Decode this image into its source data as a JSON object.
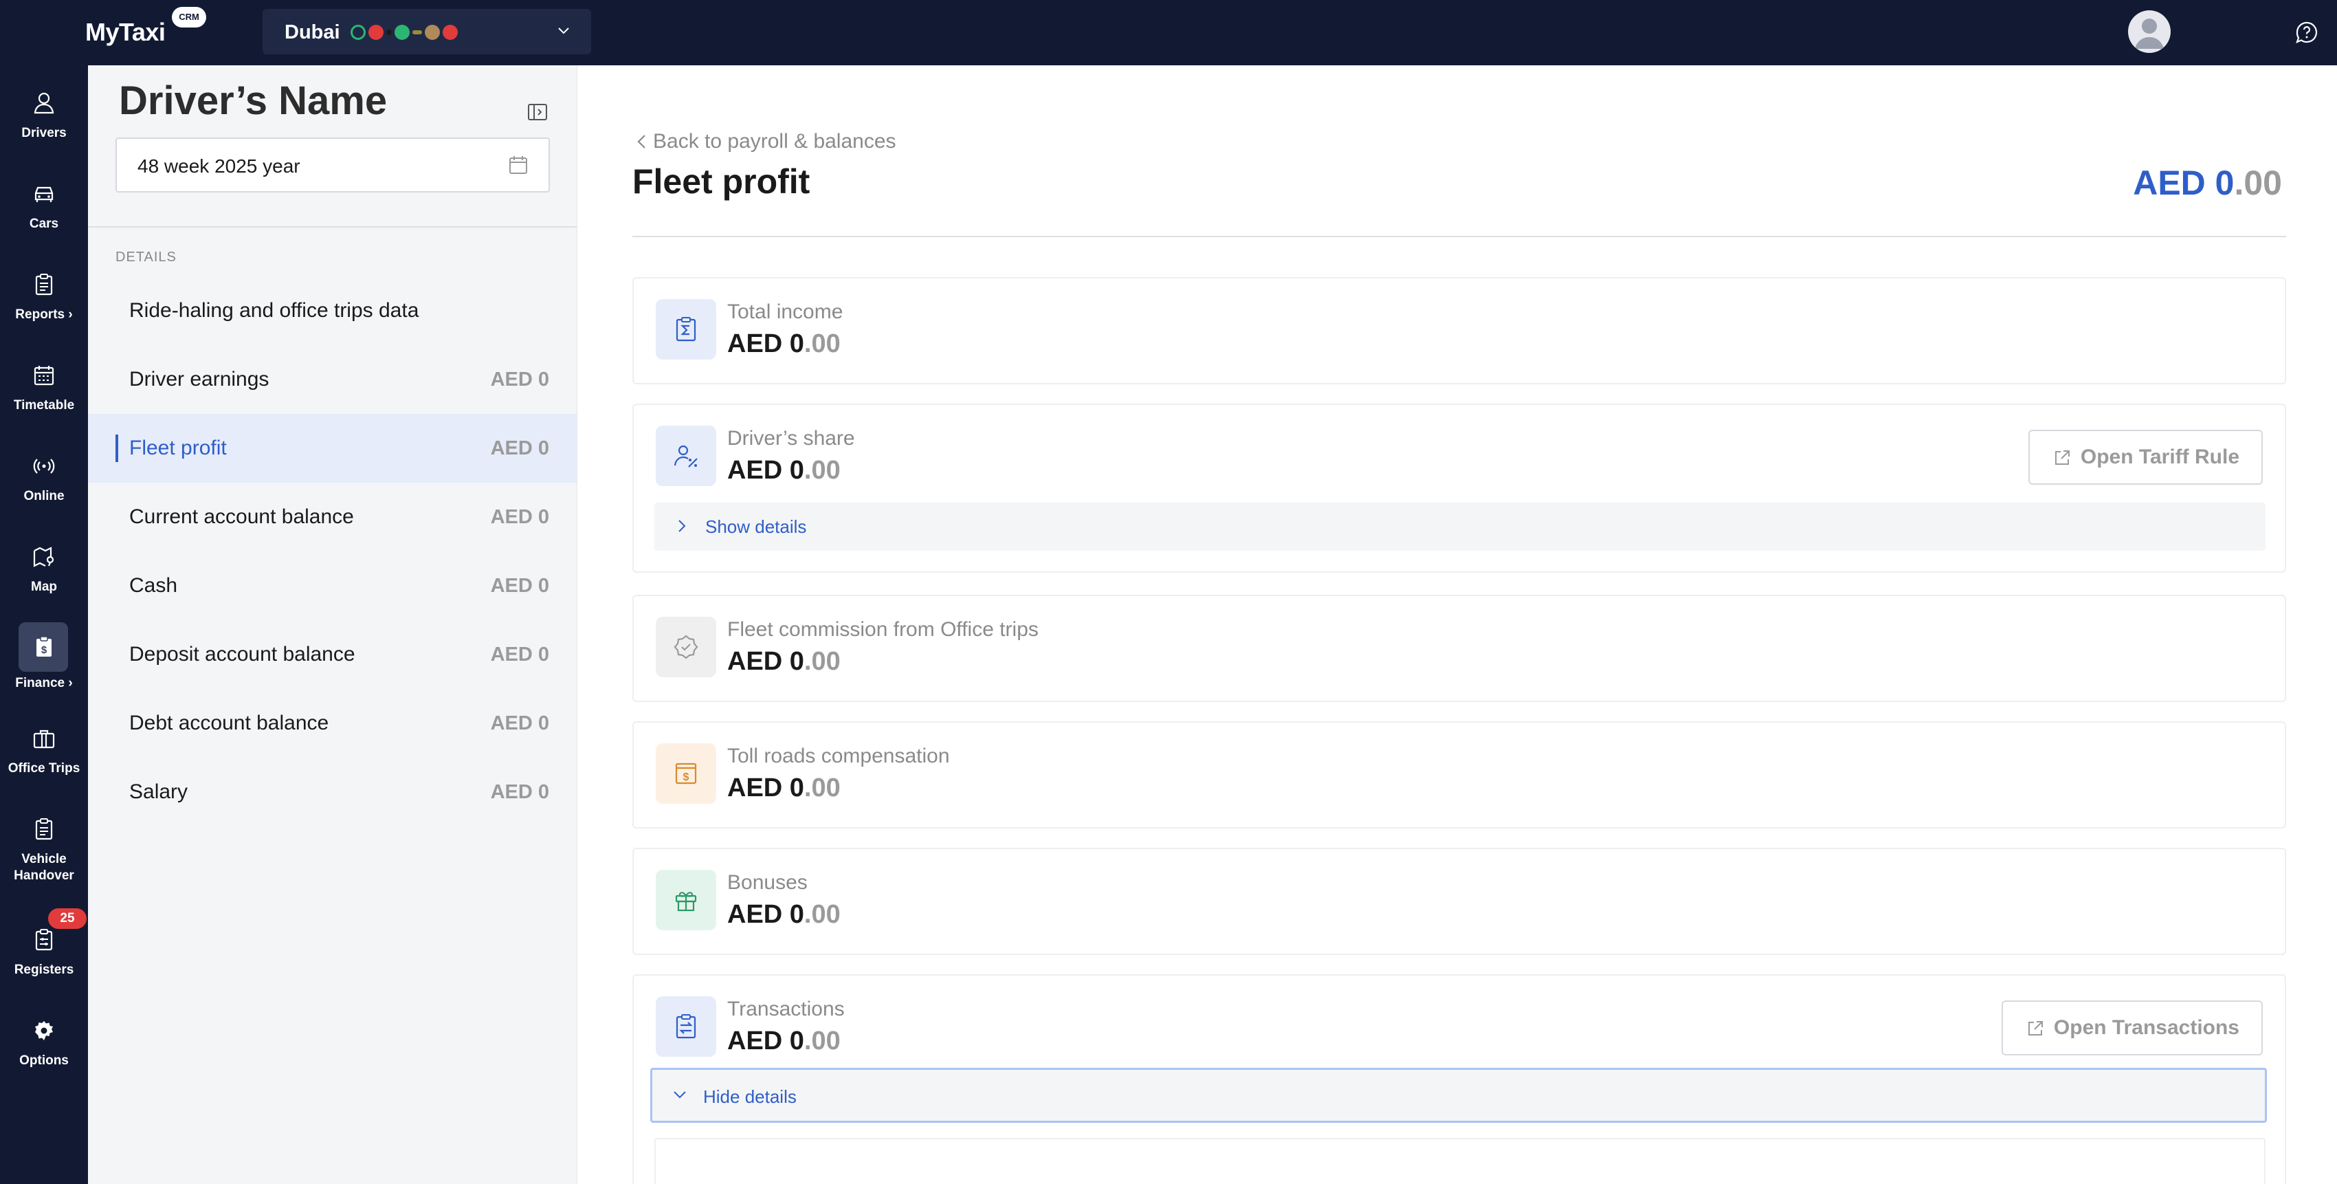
{
  "app": {
    "logo": "MyTaxi",
    "logo_badge": "CRM"
  },
  "city_selector": {
    "city": "Dubai",
    "status_dots": [
      "#2bb673",
      "#e23b3b",
      "#1b1b1b",
      "#2bb673",
      "#9b8b3a",
      "#b06a5a",
      "#e23b3b"
    ]
  },
  "rail": {
    "items": [
      {
        "label": "Drivers"
      },
      {
        "label": "Cars"
      },
      {
        "label": "Reports ›"
      },
      {
        "label": "Timetable"
      },
      {
        "label": "Online"
      },
      {
        "label": "Map"
      },
      {
        "label": "Finance ›"
      },
      {
        "label": "Office Trips"
      },
      {
        "label": "Vehicle Handover"
      },
      {
        "label": "Registers",
        "badge": "25"
      },
      {
        "label": "Options"
      }
    ]
  },
  "sidebar": {
    "title": "Driver’s Name",
    "week_value": "48 week 2025 year",
    "section_header": "DETAILS",
    "items": [
      {
        "label": "Ride-haling and office trips data",
        "amount": ""
      },
      {
        "label": "Driver earnings",
        "amount": "AED 0"
      },
      {
        "label": "Fleet profit",
        "amount": "AED 0"
      },
      {
        "label": "Current account balance",
        "amount": "AED 0"
      },
      {
        "label": "Cash",
        "amount": "AED 0"
      },
      {
        "label": "Deposit account balance",
        "amount": "AED 0"
      },
      {
        "label": "Debt account balance",
        "amount": "AED 0"
      },
      {
        "label": "Salary",
        "amount": "AED 0"
      }
    ]
  },
  "main": {
    "back_link": "Back to payroll & balances",
    "title": "Fleet profit",
    "total_currency_int": "AED 0",
    "total_decimal": ".00",
    "cards": [
      {
        "label": "Total income",
        "amount_int": "AED 0",
        "amount_dec": ".00",
        "icon": "sigma-clipboard-icon"
      },
      {
        "label": "Driver’s share",
        "amount_int": "AED 0",
        "amount_dec": ".00",
        "icon": "user-percent-icon",
        "button": "Open Tariff Rule",
        "details": "Show details"
      },
      {
        "label": "Fleet commission from Office trips",
        "amount_int": "AED 0",
        "amount_dec": ".00",
        "icon": "badge-check-icon"
      },
      {
        "label": "Toll roads compensation",
        "amount_int": "AED 0",
        "amount_dec": ".00",
        "icon": "toll-dollar-icon"
      },
      {
        "label": "Bonuses",
        "amount_int": "AED 0",
        "amount_dec": ".00",
        "icon": "gift-icon"
      },
      {
        "label": "Transactions",
        "amount_int": "AED 0",
        "amount_dec": ".00",
        "icon": "transfer-clipboard-icon",
        "button": "Open Transactions",
        "details": "Hide details"
      }
    ]
  },
  "colors": {
    "nav_dark": "#121a33",
    "accent": "#2f5ec9",
    "muted": "#9a9a9a"
  }
}
